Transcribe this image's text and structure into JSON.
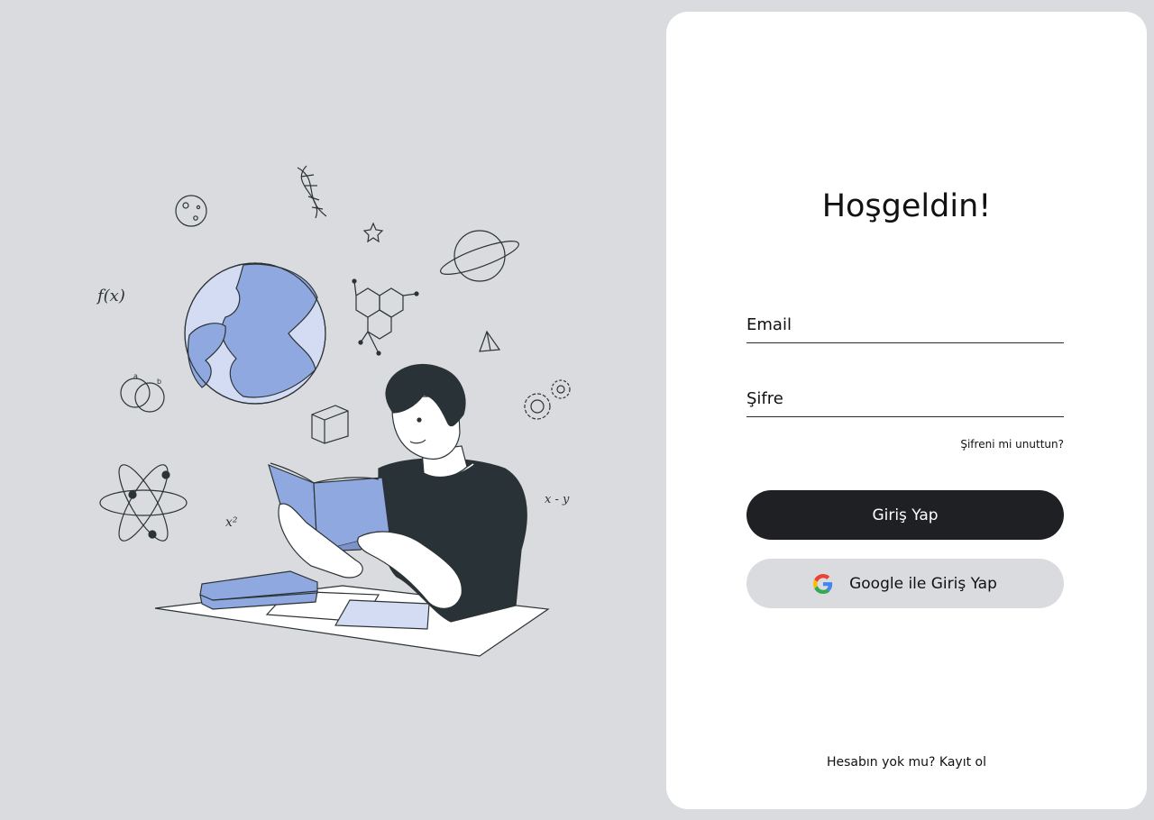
{
  "login": {
    "title": "Hoşgeldin!",
    "email_placeholder": "Email",
    "password_placeholder": "Şifre",
    "forgot_password": "Şifreni mi unuttun?",
    "login_button": "Giriş Yap",
    "google_button": "Google ile Giriş Yap",
    "signup_prompt": "Hesabın yok mu?",
    "signup_link": "Kayıt ol"
  },
  "illustration": {
    "doodle_fx": "f(x)",
    "doodle_x2": "x²",
    "doodle_xy": "x - y",
    "doodle_a": "a",
    "doodle_b": "b"
  },
  "colors": {
    "page_bg": "#dadbde",
    "card_bg": "#ffffff",
    "primary_button": "#1f2023",
    "secondary_button": "#dadbde",
    "accent_blue": "#8fa8e0"
  }
}
